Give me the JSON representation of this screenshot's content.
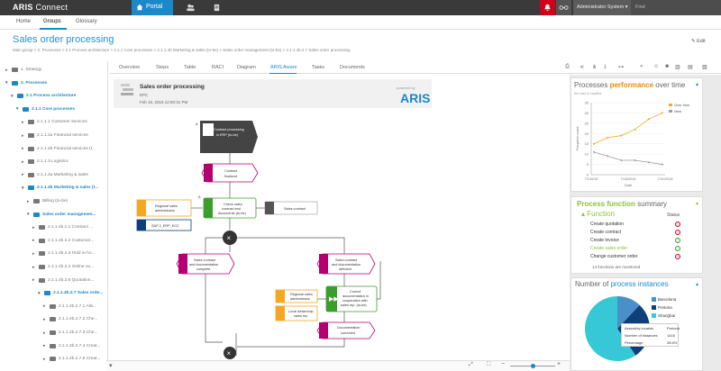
{
  "app": {
    "name": "ARIS",
    "name2": "Connect",
    "portal": "Portal",
    "user": "Administrator System",
    "find": "Find"
  },
  "nav": {
    "tabs": [
      "Home",
      "Groups",
      "Glossary"
    ]
  },
  "page": {
    "title": "Sales order processing",
    "edit": "Edit",
    "breadcrumb": "Main group  >  2. Processes  >  2.1 Process architecture  >  2.1.1 Core processes  >  2.1.1.4b Marketing & sales (to-be)  >  Sales order management (to-be)  >  2.1.1.4b.2.7 Sales order processing"
  },
  "tree": [
    {
      "label": "1. Strategy",
      "style": "g",
      "folder": "g"
    },
    {
      "label": "2. Processes",
      "style": "b",
      "folder": "b"
    },
    {
      "label": "2.1 Process architecture",
      "style": "b",
      "folder": "b"
    },
    {
      "label": "2.1.1 Core processes",
      "style": "b",
      "folder": "b"
    },
    {
      "label": "2.1.1.1 Customer services",
      "style": "g",
      "folder": "g"
    },
    {
      "label": "2.1.1.2a Financial services",
      "style": "g",
      "folder": "g"
    },
    {
      "label": "2.1.1.2b Financial services (t...",
      "style": "g",
      "folder": "g"
    },
    {
      "label": "2.1.1.3 Logistics",
      "style": "g",
      "folder": "g"
    },
    {
      "label": "2.1.1.4a Marketing & sales",
      "style": "g",
      "folder": "g"
    },
    {
      "label": "2.1.1.4b Marketing & sales (t...",
      "style": "b",
      "folder": "b"
    },
    {
      "label": "Billing (to-be)",
      "style": "g",
      "folder": "g"
    },
    {
      "label": "Sales order managemen...",
      "style": "b",
      "folder": "b"
    },
    {
      "label": "2.1.1.4b.2.1 Contract ...",
      "style": "g",
      "folder": "g"
    },
    {
      "label": "2.1.1.4b.2.2 Customer...",
      "style": "g",
      "folder": "g"
    },
    {
      "label": "2.1.1.4b.2.3 Hold in-ho...",
      "style": "g",
      "folder": "g"
    },
    {
      "label": "2.1.1.4b.2.4 Online ou...",
      "style": "g",
      "folder": "g"
    },
    {
      "label": "2.1.1.4b.2.6 Quotation...",
      "style": "g",
      "folder": "g"
    },
    {
      "label": "2.1.1.4b.2.7 Sales orde...",
      "style": "b",
      "folder": "b"
    },
    {
      "label": "2.1.1.4b.2.7.1 Allo...",
      "style": "g",
      "folder": "g"
    },
    {
      "label": "2.1.1.4b.2.7.2 Che...",
      "style": "g",
      "folder": "g"
    },
    {
      "label": "2.1.1.4b.2.7.3 Che...",
      "style": "g",
      "folder": "g"
    },
    {
      "label": "2.1.1.4b.2.7.4 Creat...",
      "style": "g",
      "folder": "g"
    },
    {
      "label": "2.1.1.4b.2.7.5 Creat...",
      "style": "g",
      "folder": "g"
    }
  ],
  "doctabs": [
    "Overview",
    "Steps",
    "Table",
    "RACI",
    "Diagram",
    "ARIS Aware",
    "Tasks",
    "Documents"
  ],
  "model": {
    "title": "Sales order processing",
    "type": "EPC",
    "date": "Feb 16, 2016 12:50:31 PM",
    "powered": "powered by",
    "brand": "ARIS"
  },
  "nodes": {
    "n1": [
      "Contract processing",
      "in ERP (to-be)"
    ],
    "n2": [
      "Contract",
      "finalized"
    ],
    "n3": [
      "Check sales",
      "contract and",
      "documents (to-be)"
    ],
    "n4": [
      "Regional sales",
      "administrator"
    ],
    "n5": [
      "SAP 2_ERP_ECC"
    ],
    "n6": [
      "Sales contract"
    ],
    "n7": [
      "Sales contract",
      "and documentation",
      "complete"
    ],
    "n8": [
      "Sales contract",
      "and documentation",
      "deficient"
    ],
    "n9": [
      "Regional sales",
      "administrator"
    ],
    "n10": [
      "Local dealership",
      "sales rep"
    ],
    "n11": [
      "Correct",
      "documentation in",
      "cooperation with",
      "sales rep. (to-be)"
    ],
    "n12": [
      "Documentation",
      "corrected"
    ]
  },
  "performance": {
    "h1": "Processes",
    "h2": "performance",
    "h3": "over time",
    "sub": "the last 6 months",
    "ylabel": "Frequent count",
    "xlabel": "Date"
  },
  "chart_data": {
    "type": "line",
    "x": [
      "7/1/2016",
      "7/5/2016",
      "7/11/2016",
      "7/15/2016",
      "7/19/2016",
      "7/21/2016"
    ],
    "series": [
      {
        "name": "Over time",
        "values": [
          15,
          18,
          19,
          22,
          27,
          30
        ]
      },
      {
        "name": "New",
        "values": [
          11,
          9,
          7,
          7,
          6,
          5
        ]
      }
    ],
    "xticks": [
      "7/1/2016",
      "7/15/2016",
      "7/31/2016"
    ],
    "yticks": [
      "0",
      "5",
      "10",
      "15",
      "20",
      "25",
      "30",
      "35"
    ],
    "ylim": [
      0,
      35
    ],
    "xlabel": "Date",
    "ylabel": "Frequent count",
    "legend": "top-right",
    "colors": {
      "Over time": "#f5a623",
      "New": "#9b9b9b"
    }
  },
  "functions": {
    "h1": "Process function",
    "h2": "summary",
    "col1": "Function",
    "col2": "Status",
    "rows": [
      "Create quotation",
      "Create contract",
      "Create invoice",
      "Create sales order",
      "Change customer order"
    ],
    "note": "14 functions are monitored"
  },
  "instances": {
    "h1": "Number of",
    "h2": "process instances",
    "legend": [
      "Barcelona",
      "Pretoria",
      "Shanghai"
    ],
    "colors": [
      "#4a90c8",
      "#0d3f7a",
      "#36c8d6"
    ],
    "tooltip": {
      "k1": "Assembly location",
      "v1": "Pretoria",
      "k2": "Number of instances",
      "v2": "1415",
      "k3": "Percentage",
      "v3": "28.5%"
    },
    "shares": [
      12,
      28.5,
      59.5
    ]
  }
}
